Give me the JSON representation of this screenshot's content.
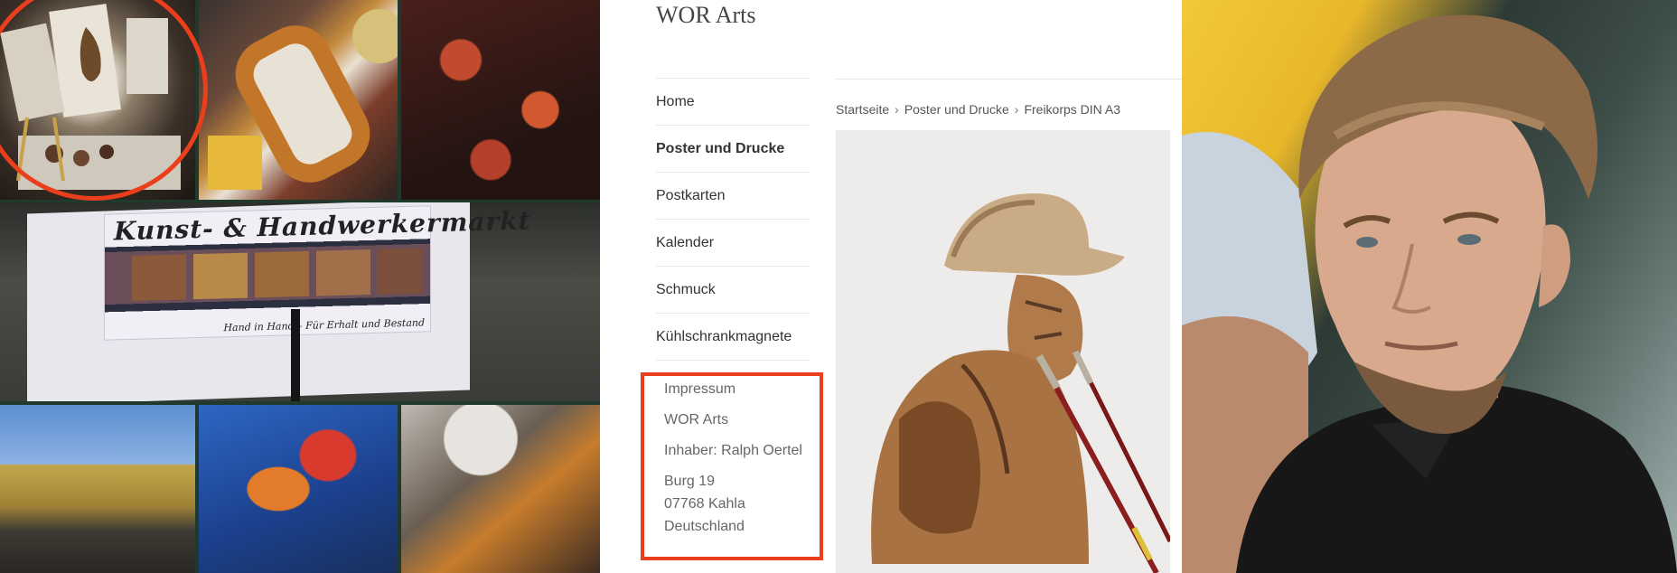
{
  "collage": {
    "banner_title": "Kunst- & Handwerkermarkt",
    "banner_sub": "Hand in Hand – Für Erhalt und Bestand"
  },
  "site": {
    "title": "WOR Arts",
    "nav": [
      {
        "label": "Home",
        "active": false
      },
      {
        "label": "Poster und Drucke",
        "active": true
      },
      {
        "label": "Postkarten",
        "active": false
      },
      {
        "label": "Kalender",
        "active": false
      },
      {
        "label": "Schmuck",
        "active": false
      },
      {
        "label": "Kühlschrankmagnete",
        "active": false
      }
    ],
    "breadcrumb": [
      "Startseite",
      "Poster und Drucke",
      "Freikorps DIN A3"
    ],
    "imprint": {
      "heading": "Impressum",
      "company": "WOR Arts",
      "owner": "Inhaber: Ralph Oertel",
      "street": "Burg 19",
      "city": "07768 Kahla",
      "country": "Deutschland"
    }
  },
  "colors": {
    "highlight": "#ea3e1c",
    "text": "#333333",
    "muted": "#666666",
    "divider": "#e6e6e6"
  }
}
